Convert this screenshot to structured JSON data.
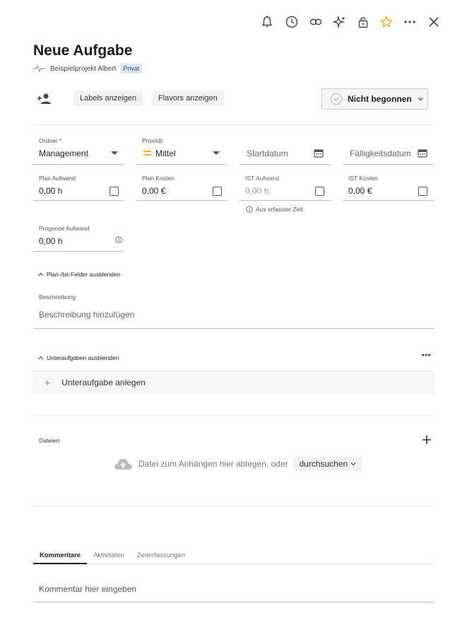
{
  "header": {
    "title": "Neue Aufgabe",
    "project": "Beispielprojekt Albert",
    "visibility_badge": "Privat",
    "star_color": "#f2b50c"
  },
  "toolbar": {
    "icons": [
      "bell-icon",
      "clock-icon",
      "link-icon",
      "sparkle-icon",
      "lock-icon",
      "star-icon",
      "more-icon",
      "close-icon"
    ]
  },
  "actions": {
    "show_labels": "Labels anzeigen",
    "show_flavors": "Flavors anzeigen",
    "status": "Nicht begonnen"
  },
  "fields": {
    "folder": {
      "label": "Ordner *",
      "value": "Management"
    },
    "priority": {
      "label": "Priorität",
      "value": "Mittel",
      "color": "#f2b50c"
    },
    "start_date": {
      "placeholder": "Startdatum"
    },
    "due_date": {
      "placeholder": "Fälligkeitsdatum"
    },
    "plan_effort": {
      "label": "Plan Aufwand",
      "value": "0,00 h"
    },
    "plan_cost": {
      "label": "Plan Kosten",
      "value": "0,00 €"
    },
    "actual_effort": {
      "label": "IST Aufwand",
      "value": "0,00 h",
      "hint": "Aus erfasster Zeit"
    },
    "actual_cost": {
      "label": "IST Kosten",
      "value": "0,00 €"
    },
    "forecast_effort": {
      "label": "Prognose Aufwand",
      "value": "0,00 h"
    }
  },
  "plan_actual_toggle": "Plan-/Ist-Felder ausblenden",
  "description": {
    "label": "Beschreibung",
    "placeholder": "Beschreibung hinzufügen"
  },
  "subtasks": {
    "toggle": "Unteraufgaben ausblenden",
    "add": "Unteraufgabe anlegen"
  },
  "files": {
    "label": "Dateien",
    "drop_text": "Datei zum Anhängen hier ablegen, oder",
    "browse": "durchsuchen"
  },
  "tabs": [
    "Kommentare",
    "Aktivitäten",
    "Zeiterfassungen"
  ],
  "comment": {
    "placeholder": "Kommentar hier eingeben"
  }
}
